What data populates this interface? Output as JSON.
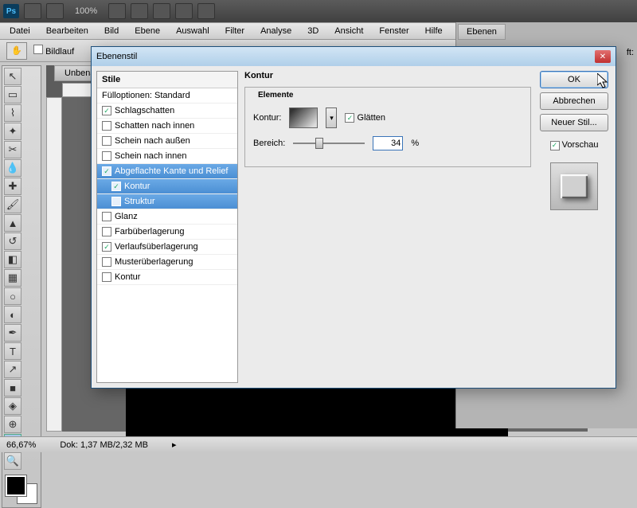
{
  "topbar": {
    "logo": "Ps",
    "zoom_display": "100%"
  },
  "menubar": {
    "items": [
      "Datei",
      "Bearbeiten",
      "Bild",
      "Ebene",
      "Auswahl",
      "Filter",
      "Analyse",
      "3D",
      "Ansicht",
      "Fenster",
      "Hilfe"
    ]
  },
  "optbar": {
    "checkbox_label": "Bildlauf"
  },
  "doc": {
    "tab_label": "Unbena"
  },
  "panels": {
    "tab_layers": "Ebenen",
    "suffix": "ft:"
  },
  "dialog": {
    "title": "Ebenenstil",
    "styles_header": "Stile",
    "fill_opts": "Fülloptionen: Standard",
    "items": [
      {
        "label": "Schlagschatten",
        "checked": true
      },
      {
        "label": "Schatten nach innen",
        "checked": false
      },
      {
        "label": "Schein nach außen",
        "checked": false
      },
      {
        "label": "Schein nach innen",
        "checked": false
      },
      {
        "label": "Abgeflachte Kante und Relief",
        "checked": true,
        "sel": true
      },
      {
        "label": "Kontur",
        "checked": true,
        "sel": true,
        "sub": true
      },
      {
        "label": "Struktur",
        "checked": false,
        "sel": true,
        "sub": true
      },
      {
        "label": "Glanz",
        "checked": false
      },
      {
        "label": "Farbüberlagerung",
        "checked": false
      },
      {
        "label": "Verlaufsüberlagerung",
        "checked": true
      },
      {
        "label": "Musterüberlagerung",
        "checked": false
      },
      {
        "label": "Kontur",
        "checked": false
      }
    ],
    "panel_title": "Kontur",
    "elements_label": "Elemente",
    "contour_label": "Kontur:",
    "antialias_label": "Glätten",
    "range_label": "Bereich:",
    "range_value": "34",
    "range_unit": "%",
    "ok": "OK",
    "cancel": "Abbrechen",
    "newstyle": "Neuer Stil...",
    "preview_label": "Vorschau"
  },
  "status": {
    "zoom": "66,67%",
    "dok": "Dok: 1,37 MB/2,32 MB"
  }
}
